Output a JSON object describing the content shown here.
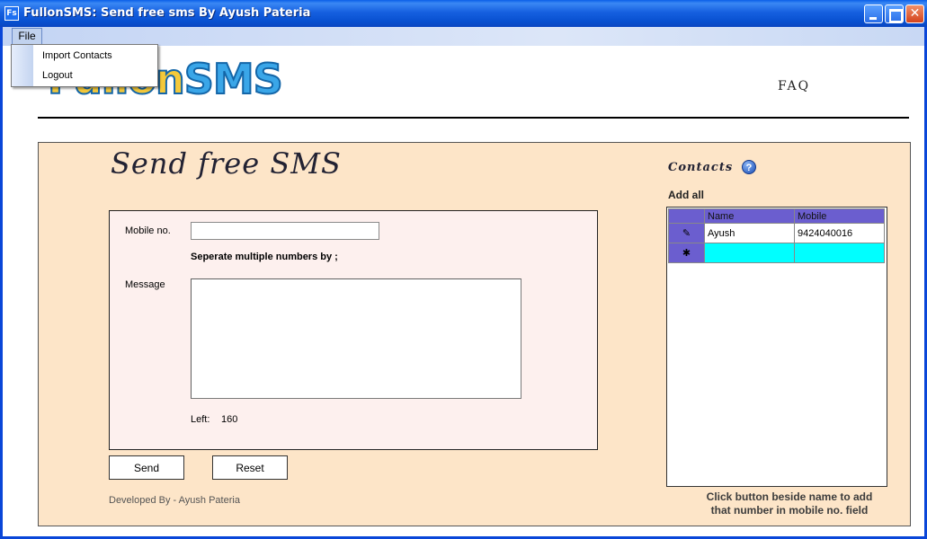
{
  "window": {
    "title": "FullonSMS: Send free sms By Ayush Pateria",
    "icon_text": "Fs"
  },
  "menu": {
    "file_label": "File",
    "items": [
      "Import Contacts",
      "Logout"
    ]
  },
  "header": {
    "logo_prefix": "Fullon",
    "logo_suffix": "SMS",
    "faq_label": "FAQ"
  },
  "form": {
    "title": "Send free SMS",
    "mobile_label": "Mobile no.",
    "mobile_value": "",
    "separator_hint": "Seperate multiple numbers by ;",
    "message_label": "Message",
    "message_value": "",
    "left_label": "Left:",
    "left_count": "160",
    "send_label": "Send",
    "reset_label": "Reset",
    "developed_by": "Developed By - Ayush Pateria"
  },
  "contacts": {
    "title": "Contacts",
    "help_icon_text": "?",
    "add_all_label": "Add all",
    "columns": [
      "Name",
      "Mobile"
    ],
    "rows": [
      {
        "name": "Ayush",
        "mobile": "9424040016",
        "marker": "✎"
      }
    ],
    "new_row_marker": "✱",
    "footer_note_line1": "Click button beside name to add",
    "footer_note_line2": "that number in mobile no. field"
  },
  "colors": {
    "titlebar": "#0a5ee8",
    "panel_bg": "#fde5c8",
    "form_bg": "#fdf0ee",
    "grid_header": "#6b5ecf",
    "new_row": "#00ffff"
  }
}
